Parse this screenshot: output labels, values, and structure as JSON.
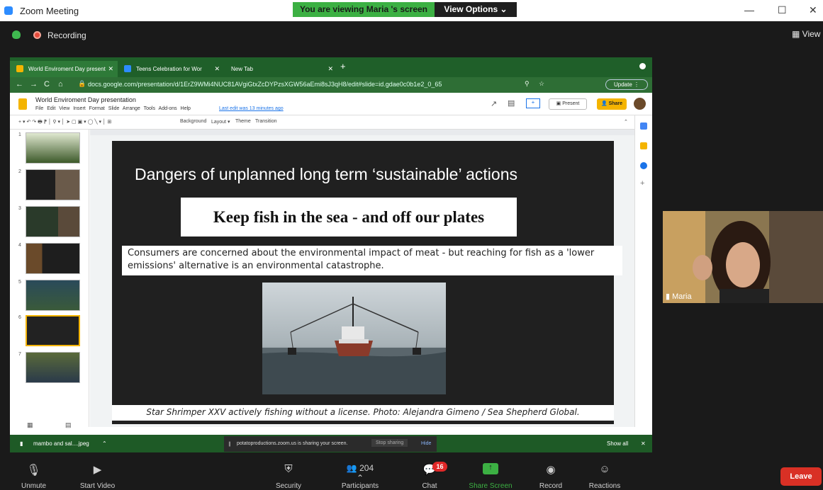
{
  "window": {
    "title": "Zoom Meeting",
    "banner": "You are viewing Maria 's screen",
    "view_options": "View Options ⌄",
    "minimize": "—",
    "maximize": "☐",
    "close": "✕"
  },
  "meeting": {
    "recording_label": "Recording",
    "view_label": "View"
  },
  "browser": {
    "tabs": [
      {
        "label": "World Enviroment Day present",
        "color": "#f4b400"
      },
      {
        "label": "Teens Celebration for Wor",
        "color": "#2d8cff"
      },
      {
        "label": "New Tab",
        "color": ""
      }
    ],
    "url": "docs.google.com/presentation/d/1ErZ9WMi4NUC81AVgiGtxZcDYPzsXGW56aEmi8sJ3qH8/edit#slide=id.gdae0c0b1e2_0_65",
    "update_label": "Update ⋮"
  },
  "docs": {
    "title": "World Enviroment Day presentation",
    "menus": "File Edit View Insert Format Slide Arrange Tools Add-ons Help",
    "last_edit": "Last edit was 13 minutes ago",
    "present_label": "▣ Present",
    "share_label": "👤 Share",
    "toolbar_background": "Background",
    "toolbar_layout": "Layout ▾",
    "toolbar_theme": "Theme",
    "toolbar_transition": "Transition",
    "slide_numbers": [
      "1",
      "2",
      "3",
      "4",
      "5",
      "6",
      "7"
    ]
  },
  "slide": {
    "title": "Dangers of unplanned long term ‘sustainable’ actions",
    "headline": "Keep fish in the sea - and off our plates",
    "subtext": "Consumers are concerned about the environmental impact of meat - but reaching for fish as a 'lower emissions' alternative is an environmental catastrophe.",
    "caption": "Star Shrimper XXV actively fishing without a license. Photo: Alejandra Gimeno / Sea Shepherd Global."
  },
  "downloads": {
    "file": "mambo and sal....jpeg",
    "show_all": "Show all"
  },
  "sharing": {
    "message": "potatoproductions.zoom.us is sharing your screen.",
    "stop": "Stop sharing",
    "hide": "Hide"
  },
  "participant": {
    "name": "Maria"
  },
  "toolbar": {
    "unmute": "Unmute",
    "start_video": "Start Video",
    "security": "Security",
    "participants": "Participants",
    "participants_count": "204",
    "chat": "Chat",
    "chat_badge": "16",
    "share_screen": "Share Screen",
    "record": "Record",
    "reactions": "Reactions",
    "leave": "Leave"
  },
  "colors": {
    "zoom_dark": "#1a1a1a",
    "banner_green": "#3cb043",
    "browser_green": "#1f5f29",
    "leave_red": "#d93025"
  }
}
